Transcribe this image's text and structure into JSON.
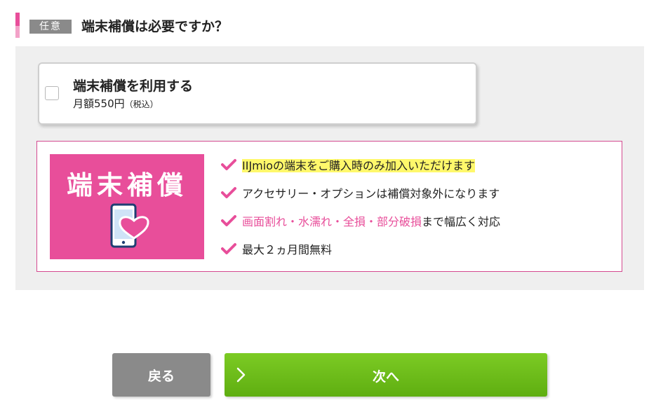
{
  "question": {
    "badge": "任意",
    "title": "端末補償は必要ですか？"
  },
  "option": {
    "name": "端末補償を利用する",
    "price": "月額550円",
    "tax": "（税込）",
    "checked": false
  },
  "promo": {
    "title": "端末補償",
    "icon": "phone-heart-icon"
  },
  "features": [
    {
      "text": "IIJmioの端末をご購入時のみ加入いただけます",
      "icon": "check-icon"
    },
    {
      "text": "アクセサリー・オプションは補償対象外になります",
      "icon": "check-icon"
    },
    {
      "highlight": "画面割れ・水濡れ・全損・部分破損",
      "rest": "まで幅広く対応",
      "icon": "check-icon"
    },
    {
      "text": "最大２ヵ月間無料",
      "icon": "check-icon"
    }
  ],
  "buttons": {
    "back": "戻る",
    "next": "次へ"
  },
  "colors": {
    "accent_pink": "#e84e9a",
    "next_green": "#6bbd1a",
    "back_gray": "#8a8a8a",
    "highlight_yellow": "#fff86b"
  }
}
